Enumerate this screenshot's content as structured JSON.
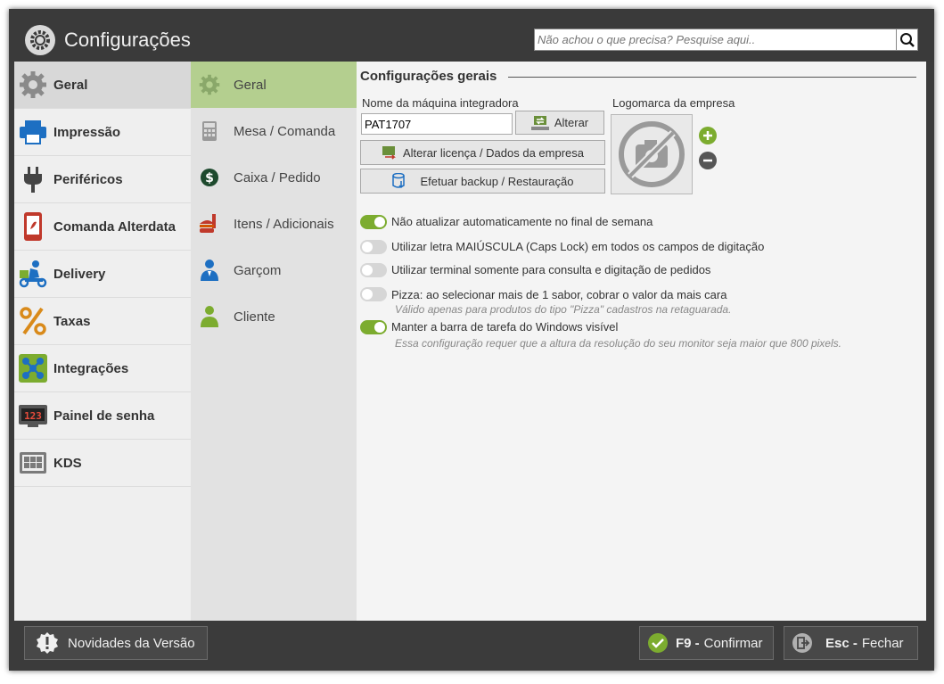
{
  "window": {
    "title": "Configurações",
    "title_icon": "gear-icon"
  },
  "search": {
    "placeholder": "Não achou o que precisa? Pesquise aqui..",
    "icon": "search-icon"
  },
  "sidebar1": {
    "items": [
      {
        "label": "Geral",
        "icon": "gear-icon",
        "active": true
      },
      {
        "label": "Impressão",
        "icon": "printer-icon"
      },
      {
        "label": "Periféricos",
        "icon": "plug-icon"
      },
      {
        "label": "Comanda Alterdata",
        "icon": "phone-order-icon"
      },
      {
        "label": "Delivery",
        "icon": "delivery-icon"
      },
      {
        "label": "Taxas",
        "icon": "percent-icon"
      },
      {
        "label": "Integrações",
        "icon": "integration-icon"
      },
      {
        "label": "Painel de senha",
        "icon": "display-panel-icon"
      },
      {
        "label": "KDS",
        "icon": "kds-icon"
      }
    ]
  },
  "sidebar2": {
    "items": [
      {
        "label": "Geral",
        "icon": "gear-icon",
        "active": true
      },
      {
        "label": "Mesa / Comanda",
        "icon": "calculator-icon"
      },
      {
        "label": "Caixa / Pedido",
        "icon": "dollar-icon"
      },
      {
        "label": "Itens / Adicionais",
        "icon": "food-icon"
      },
      {
        "label": "Garçom",
        "icon": "waiter-icon"
      },
      {
        "label": "Cliente",
        "icon": "person-icon"
      }
    ]
  },
  "main": {
    "section_title": "Configurações gerais",
    "machine_label": "Nome da máquina integradora",
    "machine_value": "PAT1707",
    "alter_button": "Alterar",
    "license_button": "Alterar licença / Dados da empresa",
    "backup_button": "Efetuar backup / Restauração",
    "logo_label": "Logomarca da empresa",
    "options": [
      {
        "label": "Não atualizar automaticamente no final de semana",
        "on": true,
        "note": ""
      },
      {
        "label": "Utilizar letra MAIÚSCULA (Caps Lock) em todos os campos de digitação",
        "on": false,
        "note": ""
      },
      {
        "label": "Utilizar terminal somente para consulta e digitação de pedidos",
        "on": false,
        "note": ""
      },
      {
        "label": "Pizza: ao selecionar mais de 1 sabor, cobrar o valor da mais cara",
        "on": false,
        "note": "Válido apenas para produtos do tipo \"Pizza\" cadastros na retaguarada."
      },
      {
        "label": "Manter a barra de tarefa do Windows visível",
        "on": true,
        "note": "Essa configuração requer que a altura da resolução do seu monitor seja maior que 800 pixels."
      }
    ]
  },
  "footer": {
    "news_button": "Novidades da Versão",
    "confirm_key": "F9 -",
    "confirm_label": "Confirmar",
    "close_key": "Esc -",
    "close_label": "Fechar"
  },
  "colors": {
    "accent_green": "#7cac2f",
    "active_submenu": "#b4cf8f",
    "titlebar": "#3a3a3a"
  }
}
